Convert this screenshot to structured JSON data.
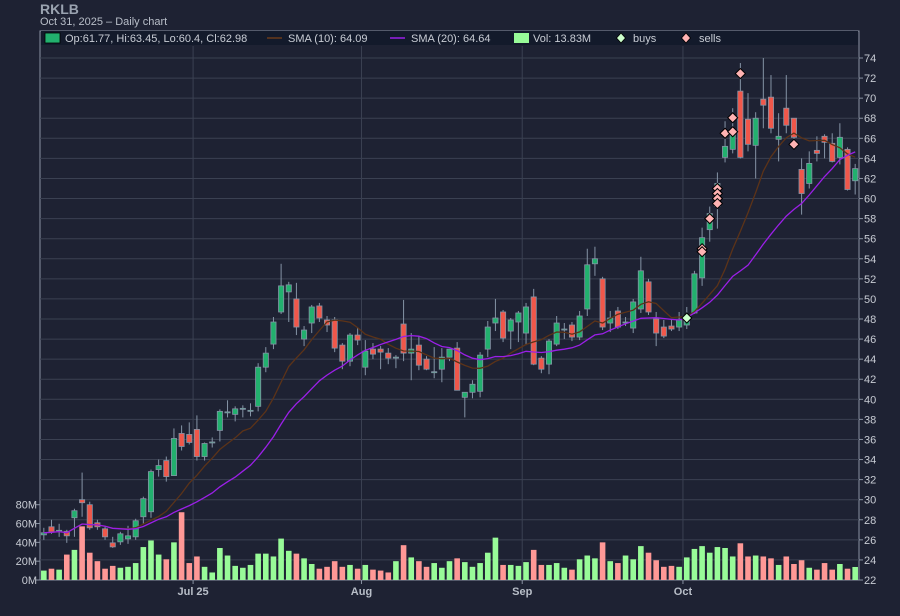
{
  "header": {
    "ticker": "RKLB",
    "subtitle": "Oct 31, 2025 – Daily chart"
  },
  "legend": {
    "ohlc": "Op:61.77, Hi:63.45, Lo:60.4, Cl:62.98",
    "sma10": "SMA (10): 64.09",
    "sma20": "SMA (20): 64.64",
    "vol": "Vol: 13.83M",
    "buys": "buys",
    "sells": "sells"
  },
  "colors": {
    "up": "#22b06e",
    "down": "#f0574a",
    "vol_up": "#98fb98",
    "vol_down": "#ff9896",
    "sma10": "#5c3318",
    "sma20": "#9b1fe8",
    "buy": "#ccffcc",
    "sell": "#ffb3b3",
    "outline": "#8594a6"
  },
  "chart_data": {
    "type": "candlestick",
    "title": "RKLB",
    "ylim": [
      22,
      74
    ],
    "yticks": [
      22,
      24,
      26,
      28,
      30,
      32,
      34,
      36,
      38,
      40,
      42,
      44,
      46,
      48,
      50,
      52,
      54,
      56,
      58,
      60,
      62,
      64,
      66,
      68,
      70,
      72,
      74
    ],
    "vol_ylim_M": [
      0,
      80
    ],
    "vol_ticks": [
      "0M",
      "20M",
      "40M",
      "60M",
      "80M"
    ],
    "xticks": [
      {
        "index": 20,
        "label": "Jul 25"
      },
      {
        "index": 42,
        "label": "Aug"
      },
      {
        "index": 63,
        "label": "Sep"
      },
      {
        "index": 84,
        "label": "Oct"
      }
    ],
    "ohlc": [
      [
        26.5,
        27.2,
        26.0,
        26.7
      ],
      [
        27.3,
        28.0,
        26.6,
        26.8
      ],
      [
        26.9,
        27.6,
        26.3,
        26.95
      ],
      [
        26.85,
        27.0,
        25.7,
        26.4
      ],
      [
        28.2,
        29.1,
        26.3,
        28.9
      ],
      [
        30.0,
        32.7,
        28.3,
        29.7
      ],
      [
        29.5,
        29.8,
        27.0,
        27.2
      ],
      [
        27.7,
        28.0,
        27.0,
        27.3
      ],
      [
        27.1,
        27.4,
        26.0,
        26.3
      ],
      [
        25.7,
        26.3,
        25.2,
        25.3
      ],
      [
        25.8,
        26.8,
        25.5,
        26.6
      ],
      [
        26.1,
        27.4,
        25.6,
        26.4
      ],
      [
        26.3,
        28.1,
        26.0,
        27.9
      ],
      [
        28.3,
        30.3,
        27.6,
        30.1
      ],
      [
        28.8,
        33.0,
        28.2,
        32.8
      ],
      [
        33.0,
        34.0,
        32.3,
        33.4
      ],
      [
        33.9,
        34.3,
        31.8,
        32.3
      ],
      [
        32.4,
        37.1,
        32.4,
        36.1
      ],
      [
        36.6,
        37.4,
        34.9,
        35.3
      ],
      [
        36.5,
        37.7,
        35.5,
        35.7
      ],
      [
        37.0,
        38.4,
        33.9,
        34.3
      ],
      [
        34.3,
        35.7,
        33.9,
        35.6
      ],
      [
        35.65,
        36.2,
        35.2,
        35.75
      ],
      [
        36.9,
        39.0,
        35.8,
        38.8
      ],
      [
        38.7,
        39.9,
        38.2,
        38.75
      ],
      [
        38.5,
        39.3,
        37.8,
        39.05
      ],
      [
        39.1,
        39.4,
        38.2,
        39.1
      ],
      [
        38.9,
        39.6,
        38.3,
        38.9
      ],
      [
        39.3,
        43.6,
        38.8,
        43.2
      ],
      [
        43.2,
        45.2,
        42.7,
        44.6
      ],
      [
        45.5,
        48.2,
        45.0,
        47.7
      ],
      [
        48.7,
        53.5,
        48.5,
        51.3
      ],
      [
        50.7,
        51.7,
        47.7,
        51.4
      ],
      [
        50.0,
        51.6,
        46.4,
        47.2
      ],
      [
        46.0,
        47.3,
        45.3,
        46.9
      ],
      [
        47.6,
        49.4,
        46.6,
        49.2
      ],
      [
        49.3,
        49.6,
        47.7,
        48.1
      ],
      [
        47.9,
        48.3,
        46.7,
        47.4
      ],
      [
        47.9,
        48.2,
        44.7,
        45.1
      ],
      [
        45.4,
        45.6,
        43.0,
        43.8
      ],
      [
        43.8,
        46.6,
        43.3,
        46.4
      ],
      [
        46.4,
        47.1,
        45.4,
        45.9
      ],
      [
        43.2,
        45.9,
        42.4,
        44.8
      ],
      [
        45.0,
        45.6,
        44.0,
        44.5
      ],
      [
        45.0,
        45.3,
        43.0,
        44.7
      ],
      [
        44.6,
        45.1,
        43.5,
        44.1
      ],
      [
        44.2,
        44.4,
        43.1,
        44.2
      ],
      [
        47.5,
        49.9,
        43.8,
        44.6
      ],
      [
        44.6,
        46.6,
        41.9,
        45.0
      ],
      [
        45.4,
        46.3,
        42.9,
        43.4
      ],
      [
        44.0,
        44.3,
        42.9,
        43.0
      ],
      [
        42.75,
        45.2,
        42.1,
        42.75
      ],
      [
        43.0,
        45.1,
        41.7,
        44.2
      ],
      [
        44.2,
        45.0,
        43.8,
        45.0
      ],
      [
        45.1,
        45.7,
        40.9,
        40.9
      ],
      [
        40.2,
        40.7,
        38.2,
        40.7
      ],
      [
        40.7,
        41.9,
        40.1,
        41.5
      ],
      [
        40.8,
        44.7,
        40.2,
        44.4
      ],
      [
        45.0,
        47.8,
        44.2,
        47.2
      ],
      [
        47.6,
        50.0,
        46.8,
        48.1
      ],
      [
        48.7,
        48.9,
        45.7,
        46.1
      ],
      [
        46.8,
        48.1,
        45.0,
        47.9
      ],
      [
        47.7,
        48.8,
        45.7,
        48.6
      ],
      [
        46.6,
        49.6,
        45.4,
        49.2
      ],
      [
        50.2,
        51.0,
        43.4,
        43.5
      ],
      [
        44.1,
        44.3,
        42.6,
        43.0
      ],
      [
        43.5,
        46.0,
        42.5,
        45.8
      ],
      [
        45.5,
        48.3,
        45.3,
        47.6
      ],
      [
        47.0,
        47.6,
        46.0,
        47.0
      ],
      [
        47.4,
        47.7,
        45.8,
        46.2
      ],
      [
        46.2,
        48.8,
        45.9,
        48.3
      ],
      [
        49.0,
        55.0,
        48.3,
        53.4
      ],
      [
        53.5,
        55.2,
        52.3,
        54.0
      ],
      [
        52.0,
        52.2,
        46.9,
        47.2
      ],
      [
        47.6,
        48.8,
        46.7,
        48.1
      ],
      [
        48.8,
        49.2,
        47.0,
        47.2
      ],
      [
        47.7,
        48.2,
        47.3,
        47.7
      ],
      [
        47.1,
        50.0,
        46.6,
        49.7
      ],
      [
        49.0,
        54.2,
        48.6,
        52.8
      ],
      [
        51.7,
        52.0,
        48.4,
        48.7
      ],
      [
        48.0,
        48.7,
        45.3,
        46.6
      ],
      [
        47.2,
        47.9,
        46.1,
        46.3
      ],
      [
        47.3,
        48.0,
        46.8,
        47.0
      ],
      [
        47.2,
        48.7,
        46.8,
        47.9
      ],
      [
        47.4,
        49.2,
        47.0,
        48.1
      ],
      [
        48.6,
        52.8,
        48.5,
        52.5
      ],
      [
        52.1,
        57.1,
        51.3,
        56.1
      ],
      [
        56.9,
        59.2,
        55.7,
        58.5
      ],
      [
        59.2,
        62.6,
        57.0,
        61.5
      ],
      [
        64.1,
        67.7,
        63.6,
        65.2
      ],
      [
        64.9,
        69.0,
        64.5,
        66.6
      ],
      [
        70.7,
        73.5,
        64.0,
        64.1
      ],
      [
        67.9,
        70.5,
        64.7,
        65.4
      ],
      [
        65.3,
        68.6,
        62.0,
        68.0
      ],
      [
        69.9,
        74.0,
        67.0,
        69.3
      ],
      [
        70.1,
        72.3,
        66.5,
        67.0
      ],
      [
        65.9,
        68.5,
        63.7,
        66.2
      ],
      [
        69.0,
        72.3,
        66.5,
        67.3
      ],
      [
        68.0,
        68.0,
        64.9,
        66.1
      ],
      [
        62.9,
        64.0,
        58.4,
        60.5
      ],
      [
        61.5,
        64.7,
        61.0,
        63.5
      ],
      [
        64.8,
        66.2,
        63.7,
        64.5
      ],
      [
        66.2,
        66.4,
        64.0,
        65.6
      ],
      [
        65.5,
        66.5,
        63.6,
        63.7
      ],
      [
        64.1,
        67.5,
        63.4,
        66.1
      ],
      [
        64.9,
        65.1,
        60.8,
        60.9
      ],
      [
        61.77,
        63.45,
        60.4,
        62.98
      ]
    ],
    "volume_M": [
      10,
      12,
      11,
      27,
      32,
      57,
      29,
      20,
      12,
      15,
      13,
      14,
      18,
      35,
      42,
      27,
      22,
      40,
      72,
      18,
      25,
      14,
      8,
      34,
      26,
      15,
      13,
      16,
      28,
      28,
      25,
      44,
      31,
      28,
      23,
      17,
      12,
      14,
      20,
      14,
      16,
      12,
      16,
      11,
      10,
      8,
      20,
      37,
      24,
      20,
      14,
      18,
      13,
      20,
      23,
      19,
      14,
      18,
      29,
      45,
      16,
      16,
      15,
      19,
      32,
      16,
      16,
      18,
      13,
      11,
      22,
      26,
      23,
      40,
      20,
      18,
      26,
      22,
      36,
      29,
      21,
      14,
      15,
      14,
      24,
      33,
      36,
      29,
      35,
      34,
      25,
      39,
      25,
      26,
      25,
      23,
      16,
      25,
      17,
      21,
      13,
      11,
      18,
      11,
      17,
      12,
      13.83
    ],
    "sma_periods": [
      10,
      20
    ],
    "buys": [
      {
        "index": 84,
        "price": 48.1
      }
    ],
    "sells": [
      {
        "index": 86,
        "price": 55.0
      },
      {
        "index": 86,
        "price": 54.7
      },
      {
        "index": 87,
        "price": 58.0
      },
      {
        "index": 88,
        "price": 61.0
      },
      {
        "index": 88,
        "price": 60.5
      },
      {
        "index": 88,
        "price": 60.0
      },
      {
        "index": 88,
        "price": 59.5
      },
      {
        "index": 89,
        "price": 66.5
      },
      {
        "index": 90,
        "price": 66.65
      },
      {
        "index": 90,
        "price": 68.05
      },
      {
        "index": 91,
        "price": 72.45
      },
      {
        "index": 98,
        "price": 65.4
      }
    ]
  }
}
